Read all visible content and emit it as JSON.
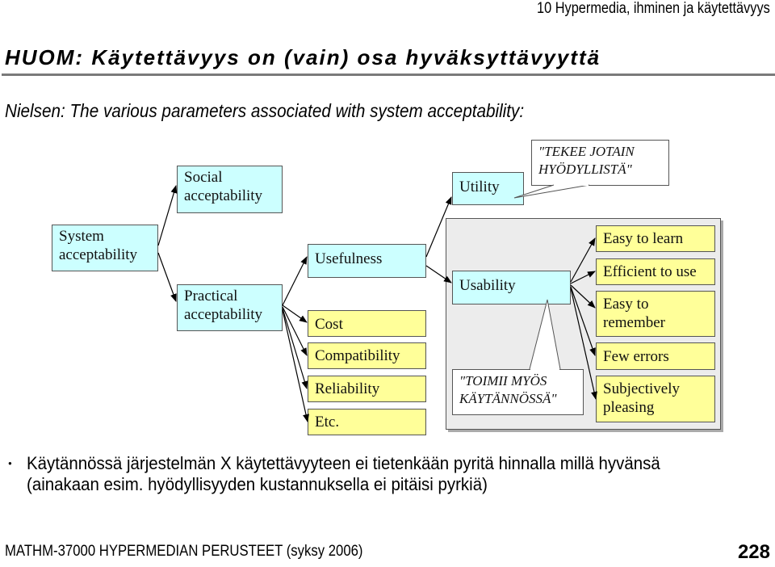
{
  "header": {
    "chapter": "10 Hypermedia, ihminen ja käytettävyys"
  },
  "slide": {
    "title": "HUOM: Käytettävyys on (vain) osa hyväksyttävyyttä",
    "subtitle": "Nielsen: The various parameters associated with system acceptability:"
  },
  "diagram": {
    "system": [
      "System",
      "acceptability"
    ],
    "social": [
      "Social",
      "acceptability"
    ],
    "practical": [
      "Practical",
      "acceptability"
    ],
    "usefulness": "Usefulness",
    "cost": "Cost",
    "compatibility": "Compatibility",
    "reliability": "Reliability",
    "etc": "Etc.",
    "utility": "Utility",
    "usability": "Usability",
    "usability_attributes": [
      [
        "Easy to learn"
      ],
      [
        "Efficient to use"
      ],
      [
        "Easy to",
        "remember"
      ],
      [
        "Few errors"
      ],
      [
        "Subjectively",
        "pleasing"
      ]
    ],
    "callout_utility": [
      "\"TEKEE JOTAIN",
      "HYÖDYLLISTÄ\""
    ],
    "callout_usability": [
      "\"TOIMII MYÖS",
      "KÄYTÄNNÖSSÄ\""
    ],
    "colors": {
      "cyan_box": "#ccffff",
      "yellow_box": "#ffff99",
      "container": "#ececec"
    }
  },
  "bullets": [
    {
      "line1": "Käytännössä järjestelmän X käytettävyyteen ei tietenkään pyritä hinnalla millä hyvänsä",
      "line2": "(ainakaan esim. hyödyllisyyden kustannuksella ei pitäisi pyrkiä)"
    }
  ],
  "footer": {
    "course": "MATHM-37000 HYPERMEDIAN PERUSTEET (syksy 2006)",
    "page_number": "228"
  }
}
